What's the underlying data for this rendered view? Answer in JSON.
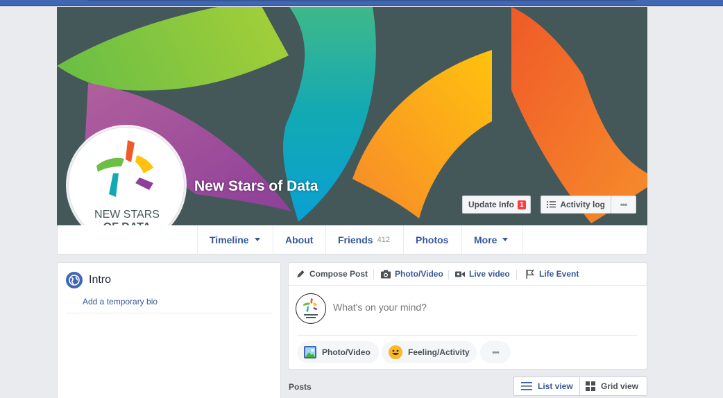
{
  "page": {
    "name": "New Stars of Data",
    "logo_text_line1": "NEW STARS",
    "logo_text_line2": "OF DATA"
  },
  "cover_actions": {
    "update_info_label": "Update Info",
    "update_info_badge": "1",
    "activity_log_label": "Activity log",
    "more_label": "•••"
  },
  "nav": {
    "items": [
      {
        "label": "Timeline",
        "count": "",
        "dropdown": true
      },
      {
        "label": "About",
        "count": "",
        "dropdown": false
      },
      {
        "label": "Friends",
        "count": "412",
        "dropdown": false
      },
      {
        "label": "Photos",
        "count": "",
        "dropdown": false
      },
      {
        "label": "More",
        "count": "",
        "dropdown": true
      }
    ]
  },
  "intro": {
    "title": "Intro",
    "bio_link": "Add a temporary bio"
  },
  "composer": {
    "tabs": {
      "compose": "Compose Post",
      "photo_video": "Photo/Video",
      "live_video": "Live video",
      "life_event": "Life Event"
    },
    "placeholder": "What's on your mind?",
    "pills": {
      "photo_video": "Photo/Video",
      "feeling": "Feeling/Activity",
      "more": "•••"
    }
  },
  "posts": {
    "label": "Posts",
    "list_view": "List view",
    "grid_view": "Grid view"
  },
  "colors": {
    "brand_blue": "#4267b2",
    "link_blue": "#365899",
    "cover_bg": "#44585a",
    "badge_red": "#fa3e3e"
  }
}
